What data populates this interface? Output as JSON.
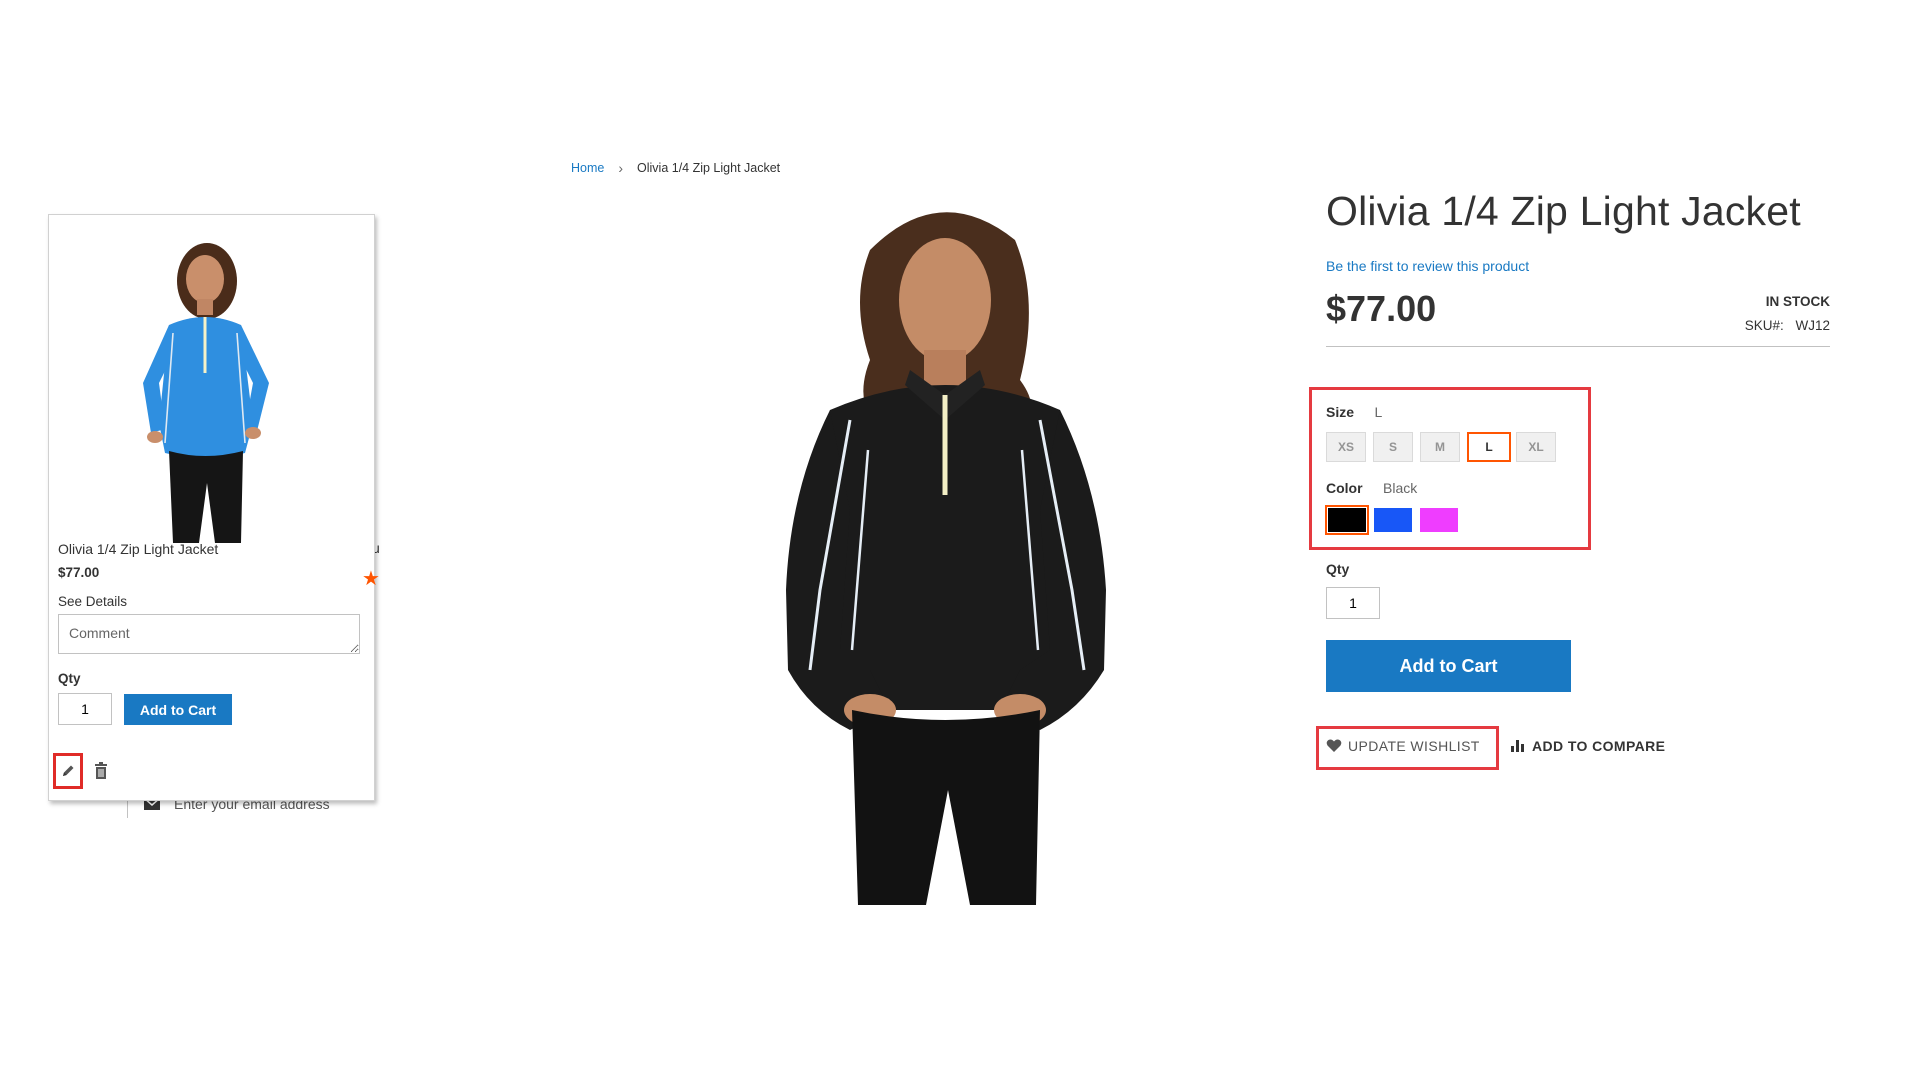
{
  "breadcrumb": {
    "home": "Home",
    "separator": "›",
    "current": "Olivia 1/4 Zip Light Jacket"
  },
  "wishlist_card": {
    "product_name": "Olivia 1/4 Zip Light Jacket",
    "price": "$77.00",
    "see_details": "See Details",
    "comment_placeholder": "Comment",
    "qty_label": "Qty",
    "qty_value": "1",
    "add_to_cart": "Add to Cart",
    "image_color": "#2f8fe0"
  },
  "background": {
    "newsletter_placeholder": "Enter your email address",
    "peek_text": "u"
  },
  "product": {
    "title": "Olivia 1/4 Zip Light Jacket",
    "review_link": "Be the first to review this product",
    "price": "$77.00",
    "stock": "IN STOCK",
    "sku_label": "SKU#:",
    "sku_value": "WJ12",
    "size_label": "Size",
    "size_selected": "L",
    "sizes": [
      "XS",
      "S",
      "M",
      "L",
      "XL"
    ],
    "color_label": "Color",
    "color_selected": "Black",
    "colors": [
      "#000000",
      "#1857f7",
      "#ef3dff"
    ],
    "qty_label": "Qty",
    "qty_value": "1",
    "add_to_cart": "Add to Cart",
    "update_wishlist": "UPDATE WISHLIST",
    "add_to_compare": "ADD TO COMPARE"
  },
  "colors": {
    "accent": "#1979c3",
    "selection": "#ff5501",
    "highlight": "#e53a40"
  }
}
